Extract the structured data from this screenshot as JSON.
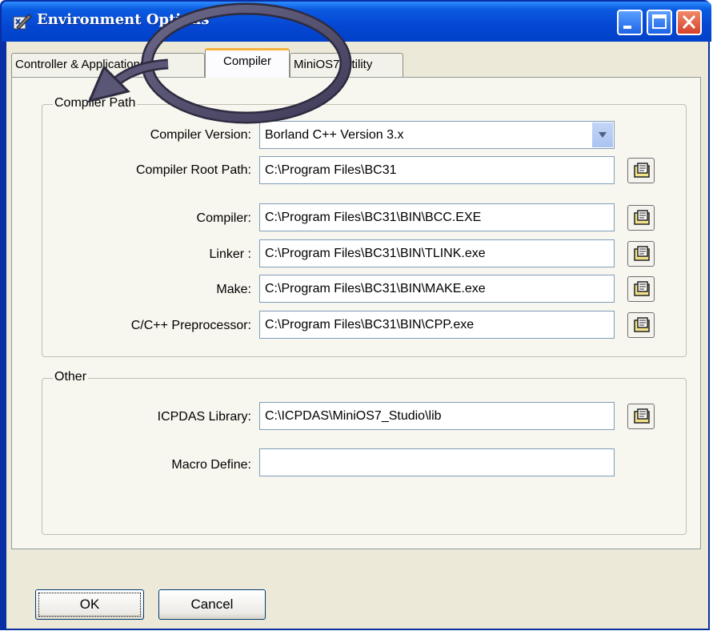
{
  "window": {
    "title": "Environment Options"
  },
  "tabs": [
    {
      "label": "Controller & Applications"
    },
    {
      "label": "Compiler"
    },
    {
      "label": "MiniOS7 Utility"
    }
  ],
  "compiler_path": {
    "legend": "Compiler Path",
    "version_label": "Compiler Version:",
    "version_value": "Borland C++ Version 3.x",
    "root_label": "Compiler Root Path:",
    "root_value": "C:\\Program Files\\BC31",
    "compiler_label": "Compiler:",
    "compiler_value": "C:\\Program Files\\BC31\\BIN\\BCC.EXE",
    "linker_label": "Linker :",
    "linker_value": "C:\\Program Files\\BC31\\BIN\\TLINK.exe",
    "make_label": "Make:",
    "make_value": "C:\\Program Files\\BC31\\BIN\\MAKE.exe",
    "preproc_label": "C/C++ Preprocessor:",
    "preproc_value": "C:\\Program Files\\BC31\\BIN\\CPP.exe"
  },
  "other": {
    "legend": "Other",
    "library_label": "ICPDAS Library:",
    "library_value": "C:\\ICPDAS\\MiniOS7_Studio\\lib",
    "macro_label": "Macro Define:",
    "macro_value": ""
  },
  "buttons": {
    "ok": "OK",
    "cancel": "Cancel"
  },
  "colors": {
    "titlebar": "#0a5be0",
    "annotation": "#4e4a6a",
    "active_tab_accent": "#f6b13e"
  },
  "icons": {
    "browse": "folder-browse-icon",
    "annotation": "circle-arrow-callout"
  }
}
